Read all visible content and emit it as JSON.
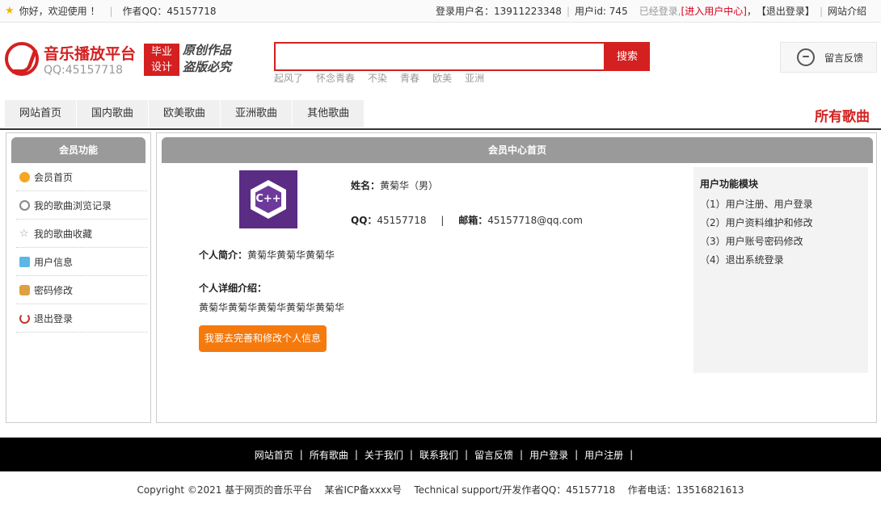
{
  "topbar": {
    "welcome": "你好，欢迎使用 ！",
    "author_qq": "作者QQ：45157718",
    "login_user": "登录用户名：13911223348",
    "user_id": "用户id: 745",
    "logged_in": "已经登录,",
    "enter_center": "[进入用户中心]",
    "logout": "【退出登录】",
    "site_intro": "网站介绍"
  },
  "logo": {
    "title": "音乐播放平台",
    "subtitle": "QQ:45157718",
    "badge_line1": "毕业",
    "badge_line2": "设计",
    "slogan_line1": "原创作品",
    "slogan_line2": "盗版必究"
  },
  "search": {
    "placeholder": "",
    "button": "搜索",
    "hotwords": [
      "起风了",
      "怀念青春",
      "不染",
      "青春",
      "欧美",
      "亚洲"
    ]
  },
  "feedback": {
    "label": "留言反馈"
  },
  "nav": {
    "items": [
      "网站首页",
      "国内歌曲",
      "欧美歌曲",
      "亚洲歌曲",
      "其他歌曲"
    ],
    "all_songs": "所有歌曲"
  },
  "sidebar": {
    "title": "会员功能",
    "items": [
      {
        "label": "会员首页",
        "icon": "home-icon"
      },
      {
        "label": "我的歌曲浏览记录",
        "icon": "history-icon"
      },
      {
        "label": "我的歌曲收藏",
        "icon": "star-icon"
      },
      {
        "label": "用户信息",
        "icon": "user-info-icon"
      },
      {
        "label": "密码修改",
        "icon": "lock-icon"
      },
      {
        "label": "退出登录",
        "icon": "power-icon"
      }
    ]
  },
  "main": {
    "title": "会员中心首页",
    "avatar_text": "C++",
    "name_label": "姓名：",
    "name_value": "黄菊华（男）",
    "qq_label": "QQ：",
    "qq_value": "45157718",
    "divider": "|",
    "email_label": "邮箱：",
    "email_value": "45157718@qq.com",
    "bio_label": "个人简介：",
    "bio_value": "黄菊华黄菊华黄菊华",
    "detail_label": "个人详细介绍：",
    "detail_value": "黄菊华黄菊华黄菊华黄菊华黄菊华",
    "edit_button": "我要去完善和修改个人信息"
  },
  "modules": {
    "title": "用户功能模块",
    "items": [
      "（1）用户注册、用户登录",
      "（2）用户资料维护和修改",
      "（3）用户账号密码修改",
      "（4）退出系统登录"
    ]
  },
  "footer": {
    "links": [
      "网站首页",
      "所有歌曲",
      "关于我们",
      "联系我们",
      "留言反馈",
      "用户登录",
      "用户注册"
    ],
    "separator": "|",
    "copyright": "Copyright ©2021 基于网页的音乐平台    某省ICP备xxxx号    Technical support/开发作者QQ：45157718    作者电话：13516821613"
  }
}
